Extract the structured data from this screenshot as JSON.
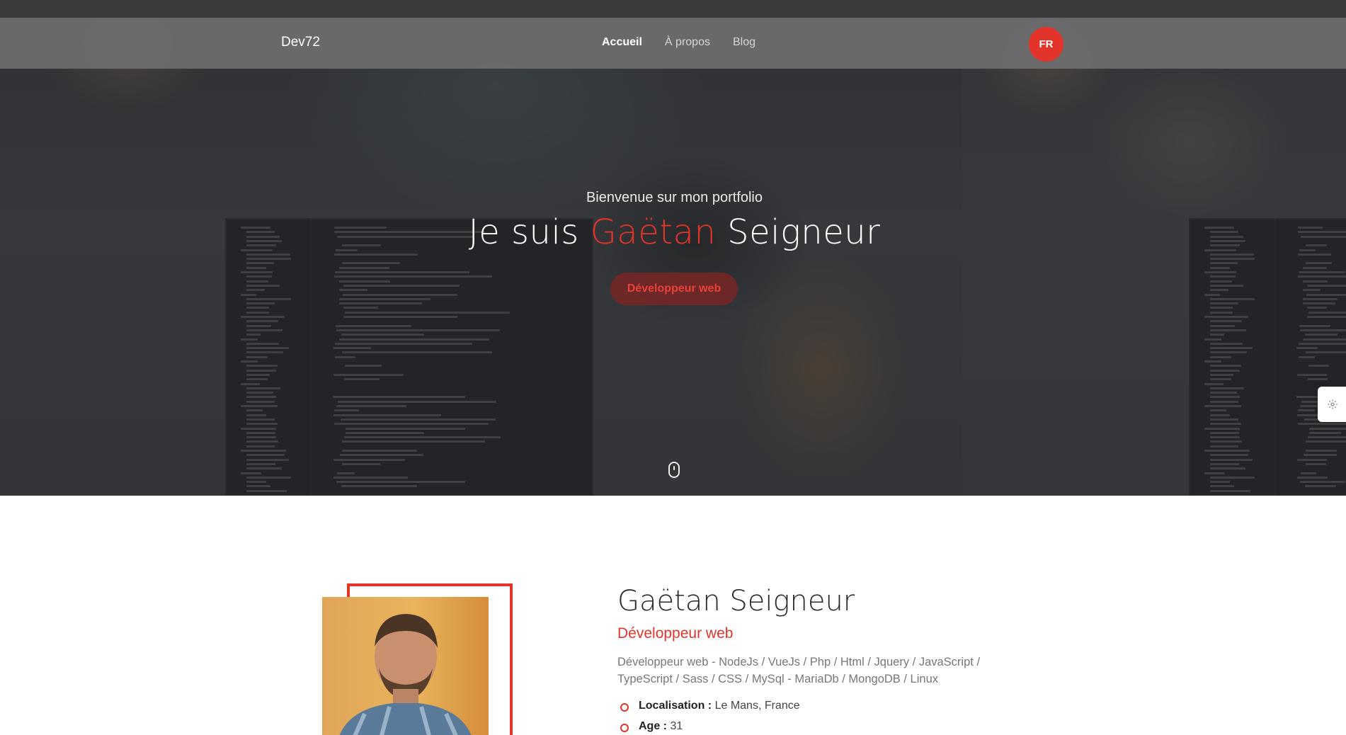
{
  "navbar": {
    "brand": "Dev72",
    "links": [
      {
        "label": "Accueil",
        "active": true
      },
      {
        "label": "À propos",
        "active": false
      },
      {
        "label": "Blog",
        "active": false
      }
    ],
    "language": "FR"
  },
  "hero": {
    "subtitle": "Bienvenue sur mon portfolio",
    "title_prefix": "Je suis ",
    "title_accent": "Gaëtan",
    "title_suffix": " Seigneur",
    "badge": "Développeur web"
  },
  "about": {
    "name": "Gaëtan Seigneur",
    "role": "Développeur web",
    "description": "Développeur web - NodeJs / VueJs / Php / Html / Jquery / JavaScript / TypeScript / Sass / CSS / MySql - MariaDb / MongoDB / Linux",
    "info": [
      {
        "label": "Localisation :",
        "value": " Le Mans, France"
      },
      {
        "label": "Age :",
        "value": " 31"
      }
    ]
  },
  "colors": {
    "accent": "#e3342c",
    "navbar": "#6e6e70",
    "text_dark": "#2a2a2a",
    "text_muted": "#777777"
  },
  "icons": {
    "settings": "gear-icon",
    "scroll": "mouse-scroll-icon"
  }
}
